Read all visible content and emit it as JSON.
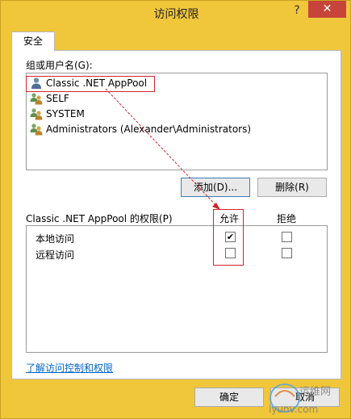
{
  "window": {
    "title": "访问权限",
    "help_label": "?",
    "close_label": "✕"
  },
  "tabs": [
    {
      "label": "安全"
    }
  ],
  "groups": {
    "label": "组或用户名(G):",
    "items": [
      {
        "name": "Classic .NET AppPool",
        "icon": "user-icon",
        "selected": true
      },
      {
        "name": "SELF",
        "icon": "users-group-icon"
      },
      {
        "name": "SYSTEM",
        "icon": "users-group-icon"
      },
      {
        "name": "Administrators (Alexander\\Administrators)",
        "icon": "users-group-icon"
      }
    ]
  },
  "buttons": {
    "add": "添加(D)...",
    "remove": "删除(R)",
    "ok": "确定",
    "cancel": "取消"
  },
  "permissions": {
    "label": "Classic .NET AppPool 的权限(P)",
    "allow_header": "允许",
    "deny_header": "拒绝",
    "rows": [
      {
        "name": "本地访问",
        "allow": true,
        "deny": false
      },
      {
        "name": "远程访问",
        "allow": false,
        "deny": false
      }
    ]
  },
  "link": "了解访问控制和权限",
  "watermark": {
    "text": "运维网",
    "url": "iyunv.com"
  },
  "colors": {
    "background": "#f0c63a",
    "close": "#c7443a",
    "annotation": "#d2232a",
    "link": "#0066cc"
  }
}
